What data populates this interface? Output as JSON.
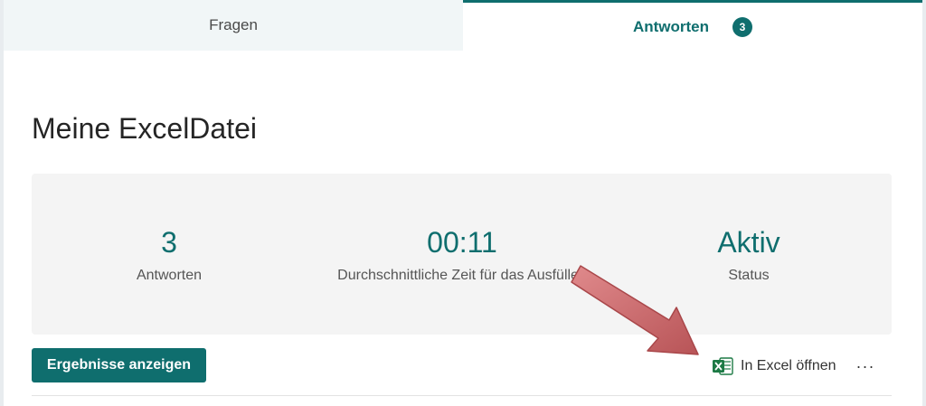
{
  "tabs": [
    {
      "label": "Fragen",
      "active": false
    },
    {
      "label": "Antworten",
      "active": true,
      "badge": "3"
    }
  ],
  "form": {
    "title": "Meine ExcelDatei"
  },
  "summary": {
    "responses": {
      "value": "3",
      "label": "Antworten"
    },
    "average_time": {
      "value": "00:11",
      "label": "Durchschnittliche Zeit für das Ausfüllen"
    },
    "status": {
      "value": "Aktiv",
      "label": "Status"
    }
  },
  "actions": {
    "view_results_label": "Ergebnisse anzeigen",
    "open_excel_label": "In Excel öffnen",
    "more_label": "···"
  },
  "icons": {
    "excel": "excel-icon",
    "more": "more-icon",
    "annotation": "arrow-icon"
  },
  "colors": {
    "accent": "#0f6e6e",
    "panel": "#f4f4f4",
    "arrow": "#c8686b"
  }
}
